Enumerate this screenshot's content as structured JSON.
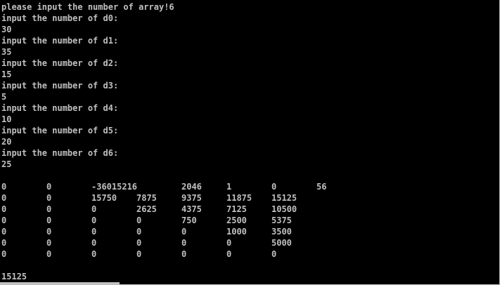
{
  "console": {
    "prompt_lines": [
      "please input the number of array!6",
      "input the number of d0:",
      "30",
      "input the number of d1:",
      "35",
      "input the number of d2:",
      "15",
      "input the number of d3:",
      "5",
      "input the number of d4:",
      "10",
      "input the number of d5:",
      "20",
      "input the number of d6:",
      "25"
    ],
    "matrix": [
      [
        "0",
        "0",
        "-36015216",
        "",
        "2046",
        "1",
        "0",
        "56"
      ],
      [
        "0",
        "0",
        "15750",
        "7875",
        "9375",
        "11875",
        "15125",
        ""
      ],
      [
        "0",
        "0",
        "0",
        "2625",
        "4375",
        "7125",
        "10500",
        ""
      ],
      [
        "0",
        "0",
        "0",
        "0",
        "750",
        "2500",
        "5375",
        ""
      ],
      [
        "0",
        "0",
        "0",
        "0",
        "0",
        "1000",
        "3500",
        ""
      ],
      [
        "0",
        "0",
        "0",
        "0",
        "0",
        "0",
        "5000",
        ""
      ],
      [
        "0",
        "0",
        "0",
        "0",
        "0",
        "0",
        "0",
        ""
      ]
    ],
    "result": "15125"
  },
  "colors": {
    "background": "#000000",
    "text": "#c0c0c0"
  }
}
